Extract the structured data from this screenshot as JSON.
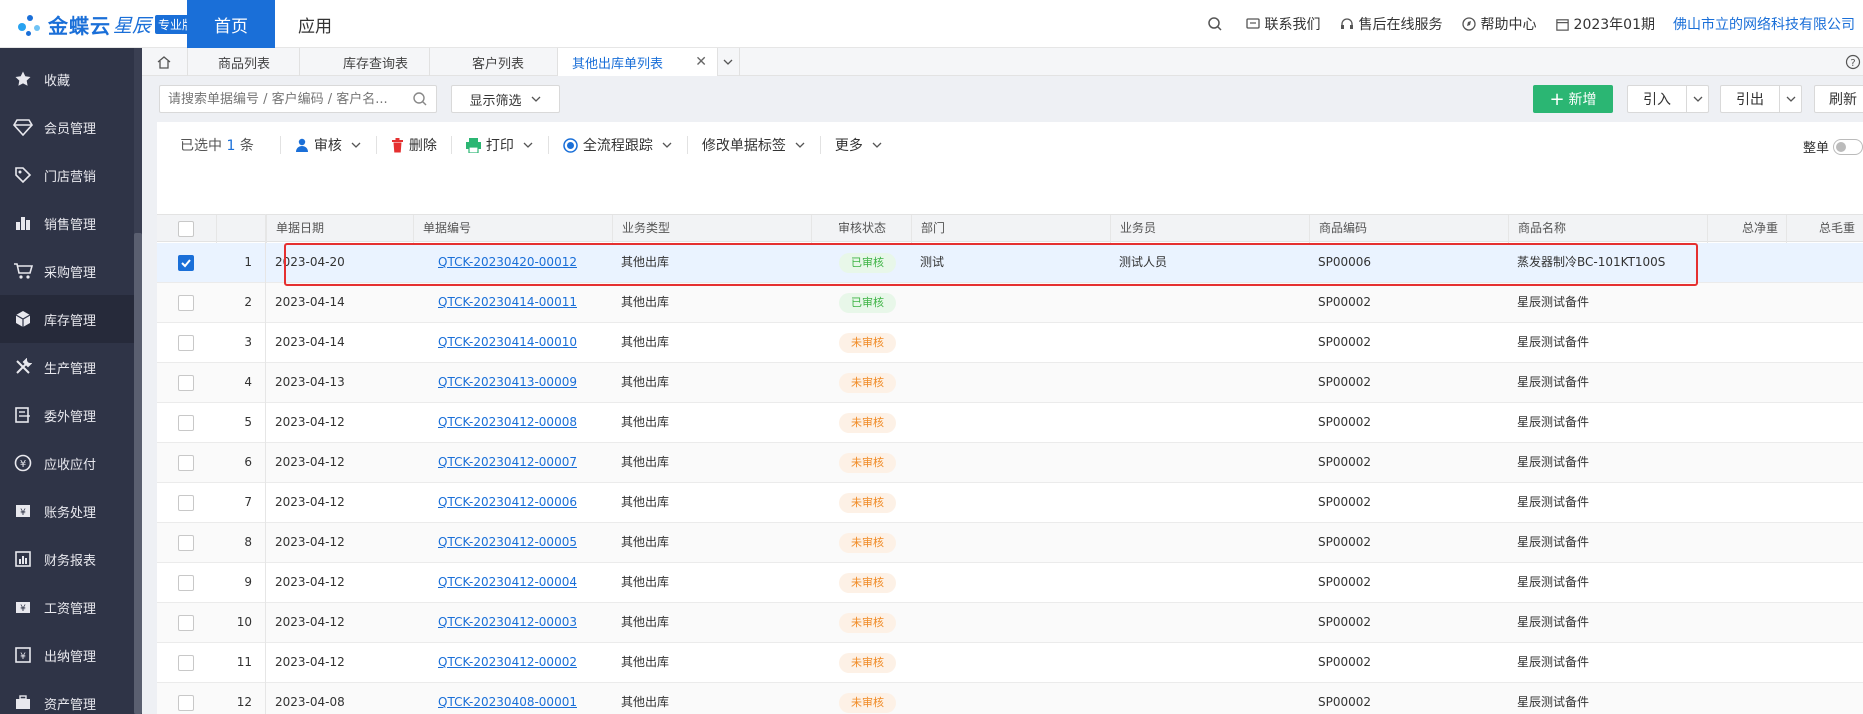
{
  "topbar": {
    "logo_text": "金蝶云",
    "logo_sub": "星辰",
    "logo_badge": "专业版",
    "nav_home": "首页",
    "nav_apps": "应用",
    "contact": "联系我们",
    "support": "售后在线服务",
    "help": "帮助中心",
    "period": "2023年01期",
    "company": "佛山市立的网络科技有限公司"
  },
  "sidebar": {
    "items": [
      {
        "label": "收藏",
        "icon": "star-icon"
      },
      {
        "label": "会员管理",
        "icon": "diamond-icon"
      },
      {
        "label": "门店营销",
        "icon": "tag-icon"
      },
      {
        "label": "销售管理",
        "icon": "bar-chart-icon"
      },
      {
        "label": "采购管理",
        "icon": "cart-icon"
      },
      {
        "label": "库存管理",
        "icon": "box-icon"
      },
      {
        "label": "生产管理",
        "icon": "tools-icon"
      },
      {
        "label": "委外管理",
        "icon": "outsource-icon"
      },
      {
        "label": "应收应付",
        "icon": "yen-circle-icon"
      },
      {
        "label": "账务处理",
        "icon": "ledger-icon"
      },
      {
        "label": "财务报表",
        "icon": "report-icon"
      },
      {
        "label": "工资管理",
        "icon": "salary-icon"
      },
      {
        "label": "出纳管理",
        "icon": "cashier-icon"
      },
      {
        "label": "资产管理",
        "icon": "asset-icon"
      }
    ]
  },
  "tabs": [
    "商品列表",
    "库存查询表",
    "客户列表",
    "其他出库单列表"
  ],
  "toolbar": {
    "search_placeholder": "请搜索单据编号 / 客户编码 / 客户名...",
    "filter": "显示筛选",
    "new": "新增",
    "import": "引入",
    "export": "引出",
    "refresh": "刷新"
  },
  "actions": {
    "selected_prefix": "已选中",
    "selected_count": "1",
    "selected_suffix": "条",
    "audit": "审核",
    "delete": "删除",
    "print": "打印",
    "trace": "全流程跟踪",
    "modify_tag": "修改单据标签",
    "more": "更多",
    "whole": "整单"
  },
  "columns": [
    "单据日期",
    "单据编号",
    "业务类型",
    "审核状态",
    "部门",
    "业务员",
    "商品编码",
    "商品名称",
    "总净重",
    "总毛重"
  ],
  "rows": [
    {
      "idx": "1",
      "date": "2023-04-20",
      "no": "QTCK-20230420-00012",
      "type": "其他出库",
      "status": "已审核",
      "dept": "测试",
      "staff": "测试人员",
      "code": "SP00006",
      "name": "蒸发器制冷BC-101KT100S"
    },
    {
      "idx": "2",
      "date": "2023-04-14",
      "no": "QTCK-20230414-00011",
      "type": "其他出库",
      "status": "已审核",
      "dept": "",
      "staff": "",
      "code": "SP00002",
      "name": "星辰测试备件"
    },
    {
      "idx": "3",
      "date": "2023-04-14",
      "no": "QTCK-20230414-00010",
      "type": "其他出库",
      "status": "未审核",
      "dept": "",
      "staff": "",
      "code": "SP00002",
      "name": "星辰测试备件"
    },
    {
      "idx": "4",
      "date": "2023-04-13",
      "no": "QTCK-20230413-00009",
      "type": "其他出库",
      "status": "未审核",
      "dept": "",
      "staff": "",
      "code": "SP00002",
      "name": "星辰测试备件"
    },
    {
      "idx": "5",
      "date": "2023-04-12",
      "no": "QTCK-20230412-00008",
      "type": "其他出库",
      "status": "未审核",
      "dept": "",
      "staff": "",
      "code": "SP00002",
      "name": "星辰测试备件"
    },
    {
      "idx": "6",
      "date": "2023-04-12",
      "no": "QTCK-20230412-00007",
      "type": "其他出库",
      "status": "未审核",
      "dept": "",
      "staff": "",
      "code": "SP00002",
      "name": "星辰测试备件"
    },
    {
      "idx": "7",
      "date": "2023-04-12",
      "no": "QTCK-20230412-00006",
      "type": "其他出库",
      "status": "未审核",
      "dept": "",
      "staff": "",
      "code": "SP00002",
      "name": "星辰测试备件"
    },
    {
      "idx": "8",
      "date": "2023-04-12",
      "no": "QTCK-20230412-00005",
      "type": "其他出库",
      "status": "未审核",
      "dept": "",
      "staff": "",
      "code": "SP00002",
      "name": "星辰测试备件"
    },
    {
      "idx": "9",
      "date": "2023-04-12",
      "no": "QTCK-20230412-00004",
      "type": "其他出库",
      "status": "未审核",
      "dept": "",
      "staff": "",
      "code": "SP00002",
      "name": "星辰测试备件"
    },
    {
      "idx": "10",
      "date": "2023-04-12",
      "no": "QTCK-20230412-00003",
      "type": "其他出库",
      "status": "未审核",
      "dept": "",
      "staff": "",
      "code": "SP00002",
      "name": "星辰测试备件"
    },
    {
      "idx": "11",
      "date": "2023-04-12",
      "no": "QTCK-20230412-00002",
      "type": "其他出库",
      "status": "未审核",
      "dept": "",
      "staff": "",
      "code": "SP00002",
      "name": "星辰测试备件"
    },
    {
      "idx": "12",
      "date": "2023-04-08",
      "no": "QTCK-20230408-00001",
      "type": "其他出库",
      "status": "未审核",
      "dept": "",
      "staff": "",
      "code": "SP00002",
      "name": "星辰测试备件"
    }
  ],
  "colors": {
    "accent": "#1a6fd8",
    "sidebar_bg": "#2f3447",
    "new_btn": "#2bb673",
    "approved": "#3eb345",
    "pending": "#f08a24",
    "highlight": "#e53030"
  }
}
